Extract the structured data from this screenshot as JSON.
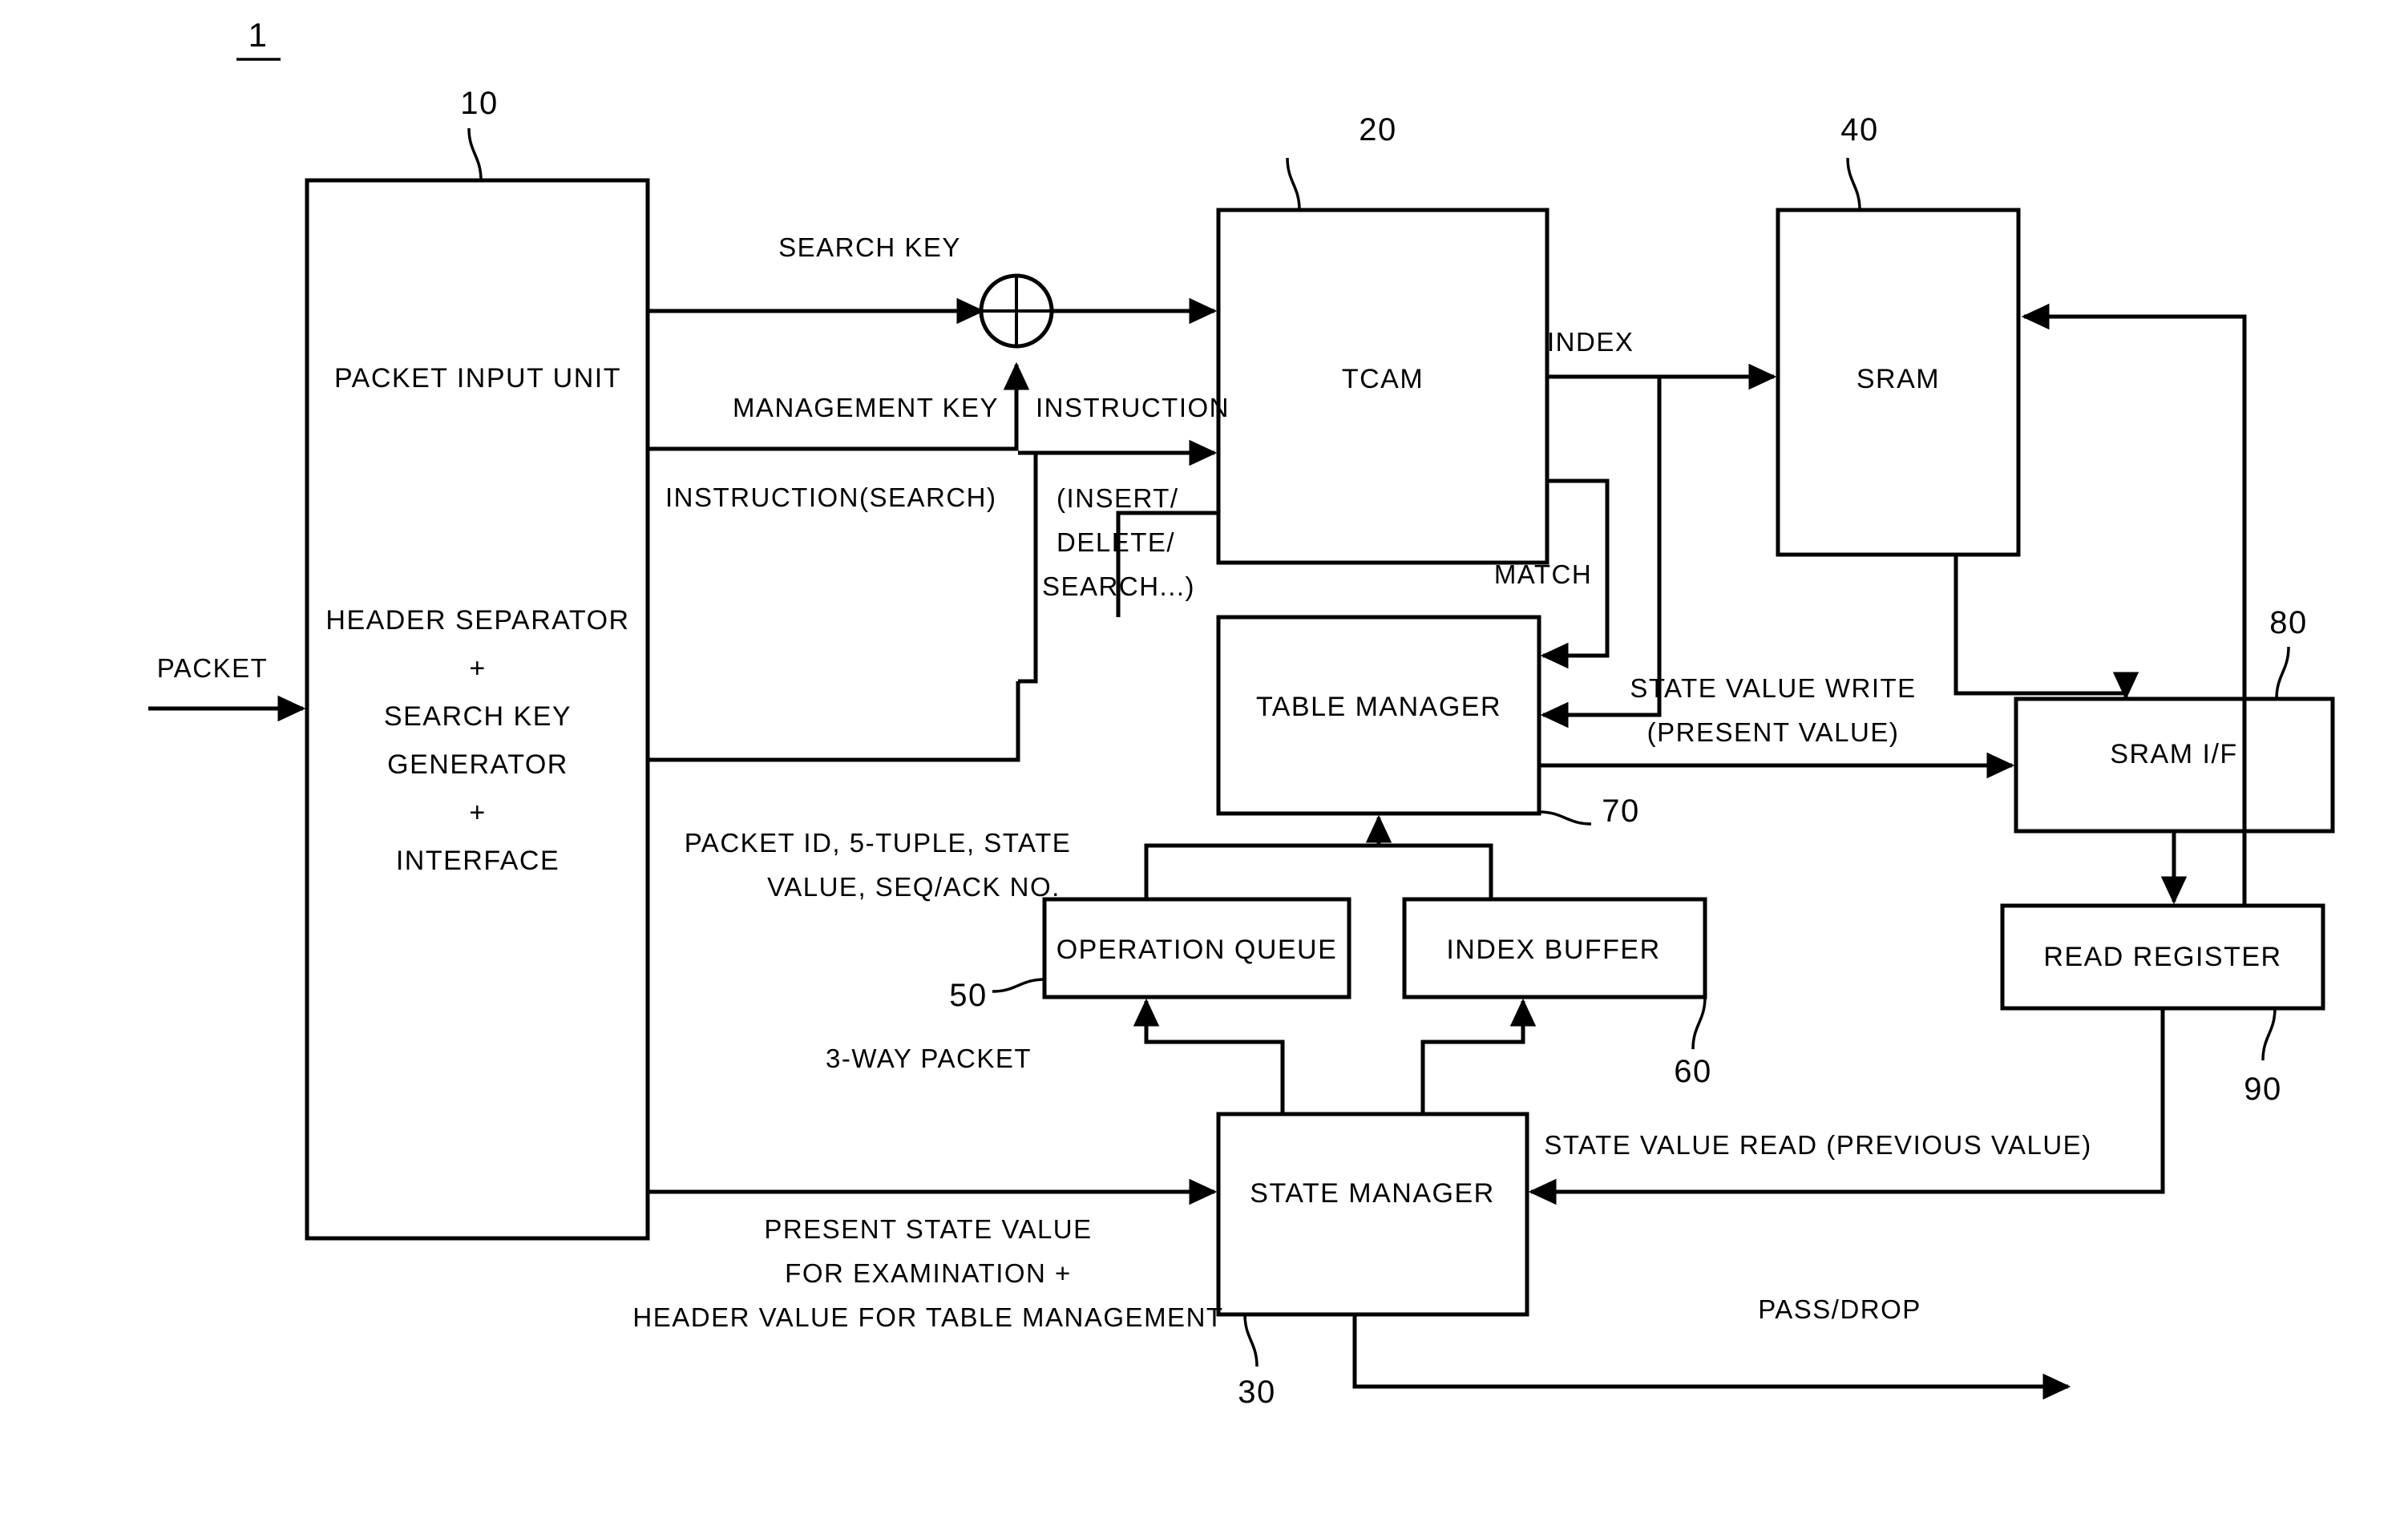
{
  "figure": {
    "figure_ref": "1",
    "blocks": [
      {
        "id": "packet_input_unit",
        "ref": "10",
        "title": "PACKET INPUT UNIT",
        "sub_lines": [
          "HEADER SEPARATOR",
          "+",
          "SEARCH KEY",
          "GENERATOR",
          "+",
          "INTERFACE"
        ]
      },
      {
        "id": "tcam",
        "ref": "20",
        "title": "TCAM"
      },
      {
        "id": "sram",
        "ref": "40",
        "title": "SRAM"
      },
      {
        "id": "table_manager",
        "ref": "70",
        "title": "TABLE MANAGER"
      },
      {
        "id": "operation_queue",
        "ref": "50",
        "title": "OPERATION QUEUE"
      },
      {
        "id": "index_buffer",
        "ref": "60",
        "title": "INDEX BUFFER"
      },
      {
        "id": "state_manager",
        "ref": "30",
        "title": "STATE MANAGER"
      },
      {
        "id": "sram_if",
        "ref": "80",
        "title": "SRAM I/F"
      },
      {
        "id": "read_register",
        "ref": "90",
        "title": "READ REGISTER"
      }
    ],
    "signals": {
      "packet_in": "PACKET",
      "search_key": "SEARCH KEY",
      "management_key": "MANAGEMENT KEY",
      "instruction_search": "INSTRUCTION(SEARCH)",
      "instruction": "INSTRUCTION",
      "instruction_detail_l1": "(INSERT/",
      "instruction_detail_l2": "DELETE/",
      "instruction_detail_l3": "SEARCH...)",
      "index": "INDEX",
      "match": "MATCH",
      "state_value_write_l1": "STATE VALUE WRITE",
      "state_value_write_l2": "(PRESENT VALUE)",
      "packet_meta_l1": "PACKET ID, 5-TUPLE, STATE",
      "packet_meta_l2": "VALUE, SEQ/ACK NO.",
      "three_way_packet": "3-WAY PACKET",
      "state_value_read": "STATE VALUE READ (PREVIOUS VALUE)",
      "present_state_l1": "PRESENT STATE VALUE",
      "present_state_l2": "FOR EXAMINATION +",
      "present_state_l3": "HEADER VALUE FOR TABLE MANAGEMENT",
      "pass_drop": "PASS/DROP"
    }
  }
}
